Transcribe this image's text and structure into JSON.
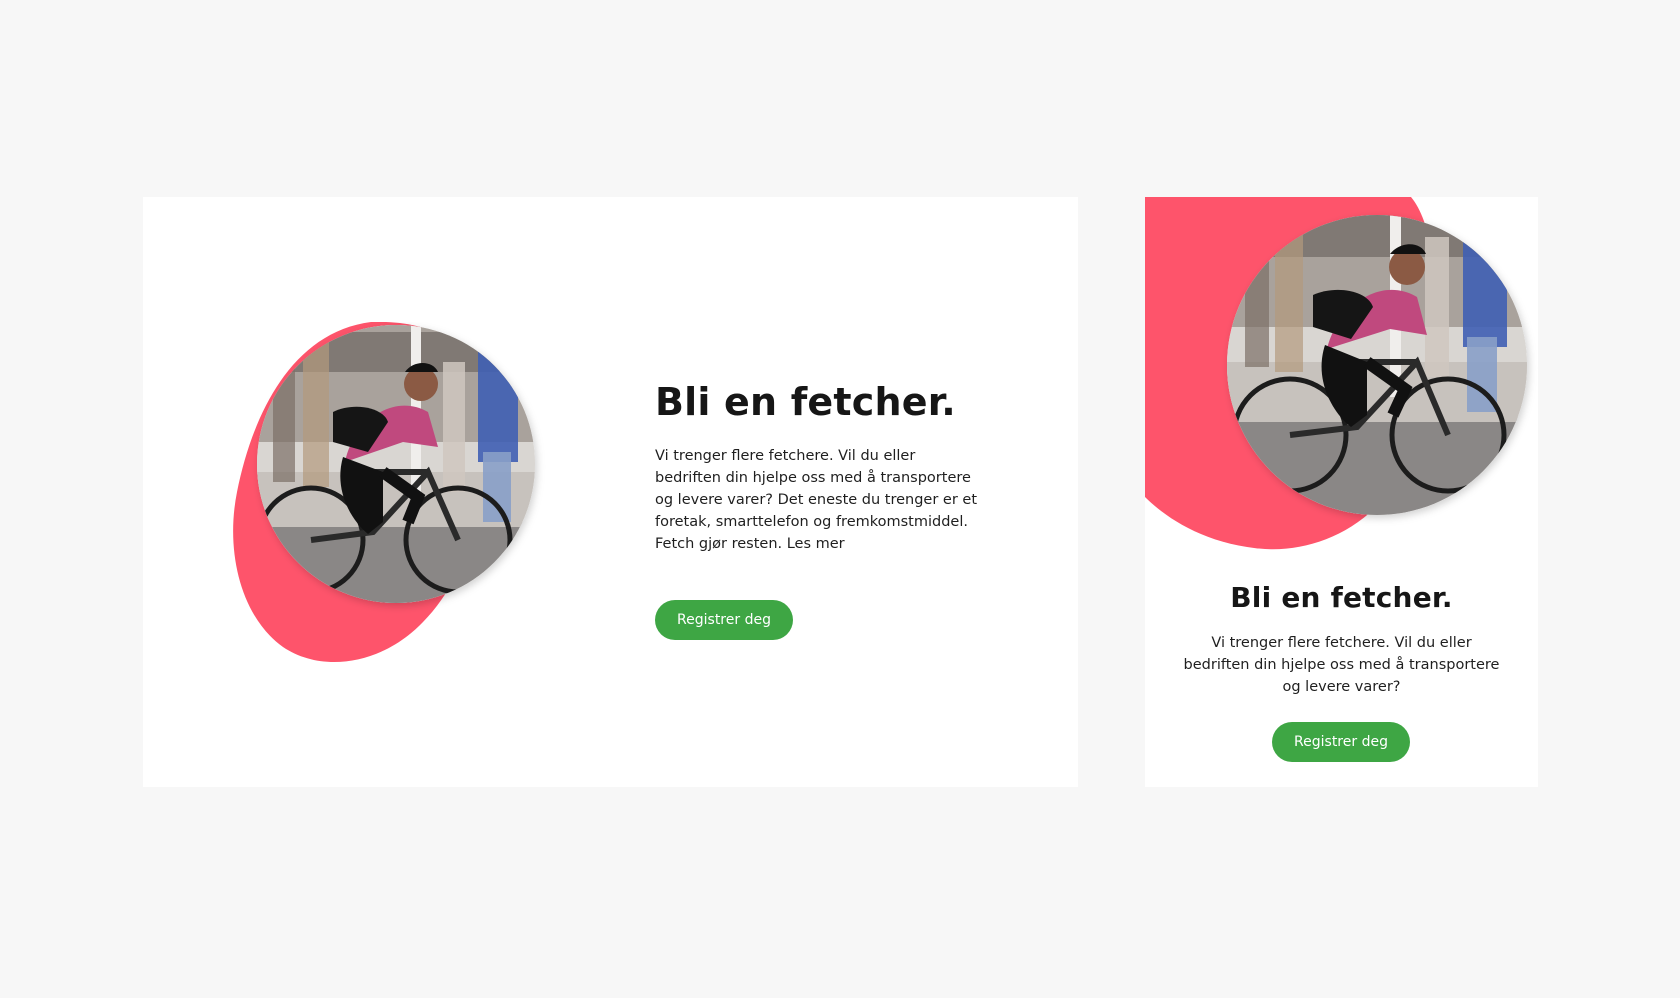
{
  "colors": {
    "page_background": "#f7f7f7",
    "card_background": "#ffffff",
    "accent_blob": "#fe546b",
    "button_green": "#3ea644",
    "text": "#161616"
  },
  "desktop_card": {
    "hero_image": "cyclist-photo",
    "title": "Bli en fetcher.",
    "body": "Vi trenger flere fetchere. Vil du eller bedriften din hjelpe oss med å transportere og levere varer? Det eneste du trenger er et foretak, smarttelefon og fremkomstmiddel. Fetch gjør resten. Les mer",
    "button_label": "Registrer deg"
  },
  "mobile_card": {
    "hero_image": "cyclist-photo",
    "title": "Bli en fetcher.",
    "body": "Vi trenger flere fetchere. Vil du eller bedriften din hjelpe oss med å transportere og levere varer?",
    "button_label": "Registrer deg"
  }
}
